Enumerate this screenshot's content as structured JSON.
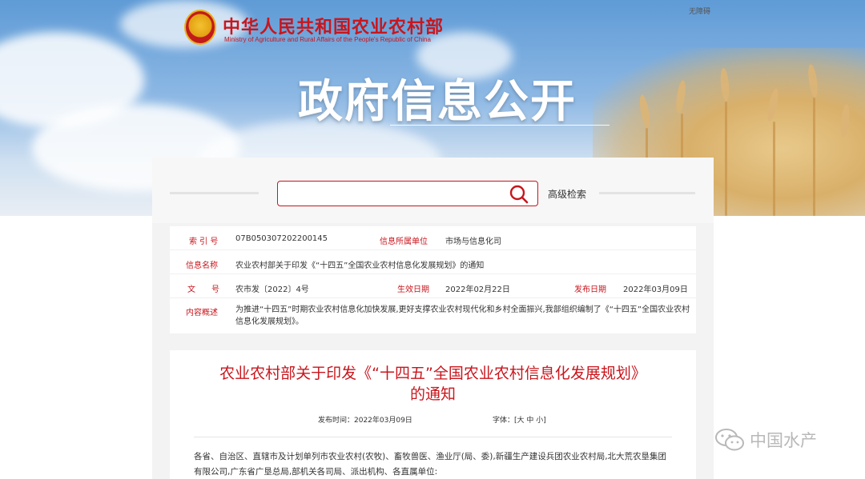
{
  "header": {
    "ministry_cn": "中华人民共和国农业农村部",
    "ministry_en": "Ministry of Agriculture and Rural Affairs of the People's Republic of China",
    "accessibility": "无障碍",
    "banner_title": "政府信息公开"
  },
  "search": {
    "placeholder": "",
    "advanced_label": "高级检索"
  },
  "info": {
    "index_label": "索 引 号",
    "index_value": "07B050307202200145",
    "unit_label": "信息所属单位",
    "unit_value": "市场与信息化司",
    "name_label": "信息名称",
    "name_value": "农业农村部关于印发《“十四五”全国农业农村信息化发展规划》的通知",
    "doc_label": "文　　号",
    "doc_value": "农市发〔2022〕4号",
    "effective_label": "生效日期",
    "effective_value": "2022年02月22日",
    "publish_label": "发布日期",
    "publish_value": "2022年03月09日",
    "summary_label": "内容概述",
    "summary_value": "为推进“十四五”时期农业农村信息化加快发展,更好支撑农业农村现代化和乡村全面振兴,我部组织编制了《“十四五”全国农业农村信息化发展规划》。"
  },
  "article": {
    "title_line1": "农业农村部关于印发《“十四五”全国农业农村信息化发展规划》",
    "title_line2": "的通知",
    "publish_time": "发布时间：2022年03月09日",
    "font_size": "字体：[大 中 小]",
    "body": "各省、自治区、直辖市及计划单列市农业农村(农牧)、畜牧兽医、渔业厅(局、委),新疆生产建设兵团农业农村局,北大荒农垦集团有限公司,广东省广垦总局,部机关各司局、派出机构、各直属单位:"
  },
  "watermark": {
    "text": "中国水产"
  },
  "colors": {
    "brand_red": "#c8161d",
    "panel_gray": "#f3f3f3"
  }
}
